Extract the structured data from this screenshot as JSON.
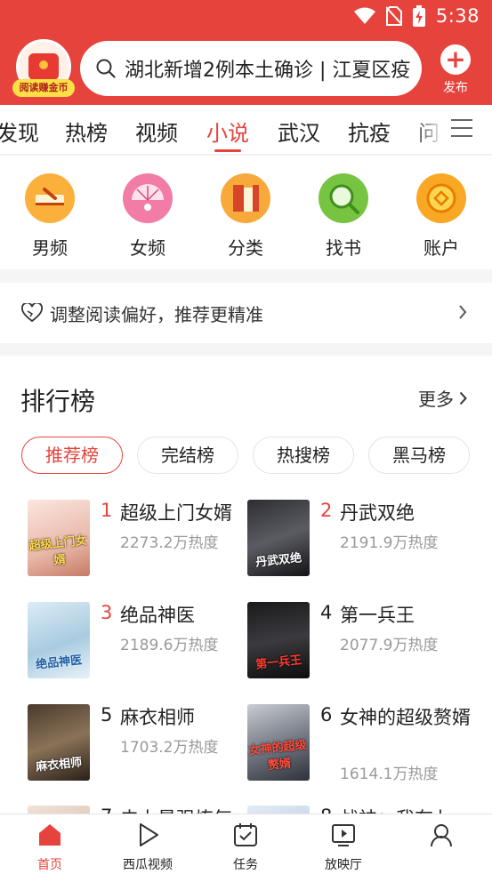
{
  "status_bar": {
    "time": "5:38"
  },
  "header": {
    "coin_badge_label": "阅读赚金币",
    "search_text": "湖北新增2例本土确诊 | 江夏区疫",
    "publish_label": "发布",
    "brand_color": "#e7433d"
  },
  "tabs": [
    "发现",
    "热榜",
    "视频",
    "小说",
    "武汉",
    "抗疫",
    "问"
  ],
  "active_tab": "小说",
  "categories": [
    {
      "label": "男频",
      "icon": "male-channel-icon"
    },
    {
      "label": "女频",
      "icon": "female-channel-icon"
    },
    {
      "label": "分类",
      "icon": "category-books-icon"
    },
    {
      "label": "找书",
      "icon": "find-book-icon"
    },
    {
      "label": "账户",
      "icon": "account-coin-icon"
    }
  ],
  "preference": {
    "text": "调整阅读偏好，推荐更精准"
  },
  "ranking": {
    "title": "排行榜",
    "more": "更多",
    "pills": [
      "推荐榜",
      "完结榜",
      "热搜榜",
      "黑马榜"
    ],
    "books": [
      {
        "rank": "1",
        "title": "超级上门女婿",
        "heat": "2273.2万热度",
        "cover_text": "超级上门女婿"
      },
      {
        "rank": "2",
        "title": "丹武双绝",
        "heat": "2191.9万热度",
        "cover_text": "丹武双绝"
      },
      {
        "rank": "3",
        "title": "绝品神医",
        "heat": "2189.6万热度",
        "cover_text": "绝品神医"
      },
      {
        "rank": "4",
        "title": "第一兵王",
        "heat": "2077.9万热度",
        "cover_text": "第一兵王"
      },
      {
        "rank": "5",
        "title": "麻衣相师",
        "heat": "1703.2万热度",
        "cover_text": "麻衣相师"
      },
      {
        "rank": "6",
        "title": "女神的超级赘婿",
        "heat": "1614.1万热度",
        "cover_text": "女神的超级赘婿"
      },
      {
        "rank": "7",
        "title": "史上最强炼气",
        "heat": "",
        "cover_text": ""
      },
      {
        "rank": "8",
        "title": "战神：我有七",
        "heat": "",
        "cover_text": ""
      }
    ]
  },
  "bottom_nav": [
    {
      "label": "首页",
      "icon": "home-icon"
    },
    {
      "label": "西瓜视频",
      "icon": "play-icon"
    },
    {
      "label": "任务",
      "icon": "task-calendar-icon"
    },
    {
      "label": "放映厅",
      "icon": "screen-play-icon"
    },
    {
      "label": "",
      "icon": "profile-icon"
    }
  ]
}
